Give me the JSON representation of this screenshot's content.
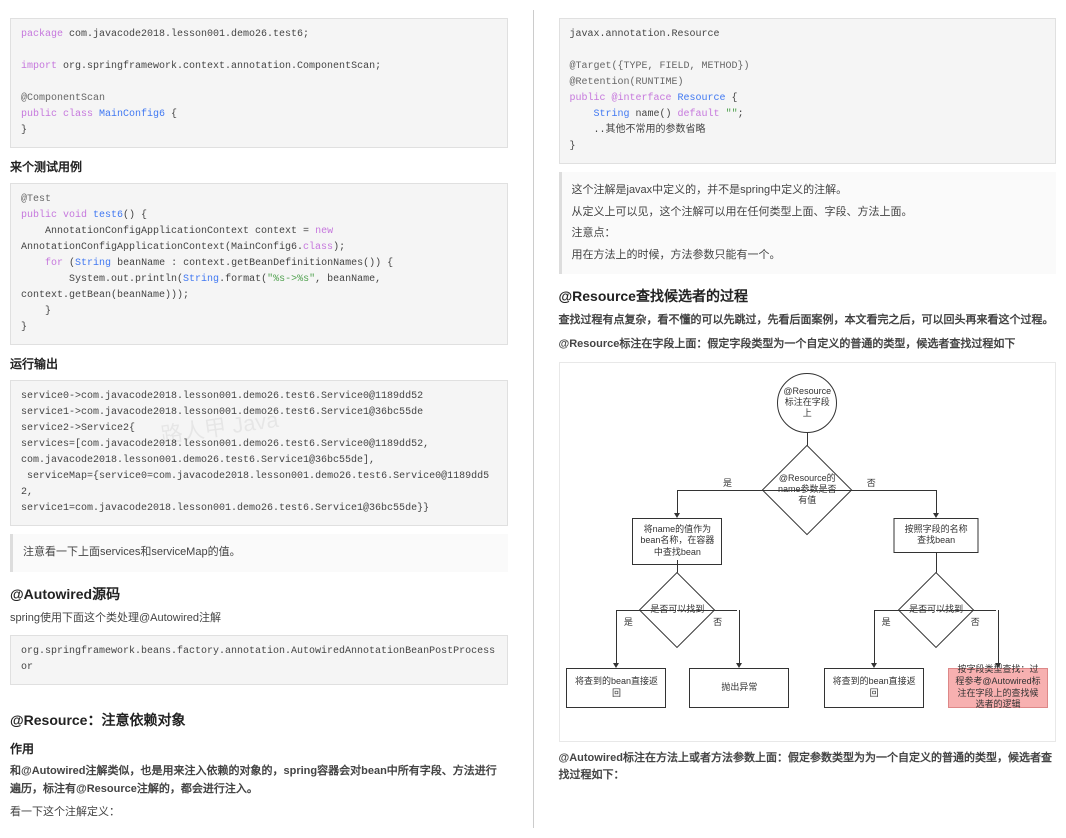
{
  "left": {
    "code1": {
      "line1_pkg": "package",
      "line1_path": " com.javacode2018.lesson001.demo26.test6;",
      "line2_import": "import",
      "line2_path": " org.springframework.context.annotation.ComponentScan;",
      "line3_annot": "@ComponentScan",
      "line4_pub": "public ",
      "line4_class": "class ",
      "line4_name": "MainConfig6",
      "line4_brace": " {",
      "line5": "}"
    },
    "h_test": "来个测试用例",
    "code2": {
      "l1": "@Test",
      "l2_pub": "public ",
      "l2_void": "void ",
      "l2_name": "test6",
      "l2_rest": "() {",
      "l3_a": "    AnnotationConfigApplicationContext context = ",
      "l3_new": "new",
      "l4": "AnnotationConfigApplicationContext(MainConfig6.",
      "l4_class": "class",
      "l4_end": ");",
      "l5_for": "    for ",
      "l5_a": "(",
      "l5_str": "String",
      "l5_b": " beanName : context.getBeanDefinitionNames()) {",
      "l6_a": "        System.out.println(",
      "l6_str": "String",
      "l6_b": ".format(",
      "l6_fmt": "\"%s->%s\"",
      "l6_c": ", beanName,",
      "l7": "context.getBean(beanName)));",
      "l8": "    }",
      "l9": "}"
    },
    "h_output": "运行输出",
    "code3": "service0->com.javacode2018.lesson001.demo26.test6.Service0@1189dd52\nservice1->com.javacode2018.lesson001.demo26.test6.Service1@36bc55de\nservice2->Service2{\nservices=[com.javacode2018.lesson001.demo26.test6.Service0@1189dd52,\ncom.javacode2018.lesson001.demo26.test6.Service1@36bc55de],\n serviceMap={service0=com.javacode2018.lesson001.demo26.test6.Service0@1189dd52,\nservice1=com.javacode2018.lesson001.demo26.test6.Service1@36bc55de}}",
    "quote1": "注意看一下上面services和serviceMap的值。",
    "h_autowired": "@Autowired源码",
    "p_spring": "spring使用下面这个类处理@Autowired注解",
    "code4": "org.springframework.beans.factory.annotation.AutowiredAnnotationBeanPostProcessor",
    "h_resource": "@Resource：注意依赖对象",
    "h_effect": "作用",
    "p_effect": "和@Autowired注解类似，也是用来注入依赖的对象的，spring容器会对bean中所有字段、方法进行遍历，标注有@Resource注解的，都会进行注入。",
    "p_look": "看一下这个注解定义："
  },
  "right": {
    "code1": {
      "l1": "javax.annotation.Resource",
      "l2_a": "@Target({TYPE, FIELD, METHOD})",
      "l3_a": "@Retention(RUNTIME)",
      "l4_pub": "public ",
      "l4_int": "@interface ",
      "l4_name": "Resource",
      "l4_end": " {",
      "l5_a": "    ",
      "l5_str": "String",
      "l5_b": " name() ",
      "l5_def": "default ",
      "l5_val": "\"\"",
      "l5_end": ";",
      "l6": "    ..其他不常用的参数省略",
      "l7": "}"
    },
    "quote1": {
      "p1": "这个注解是javax中定义的，并不是spring中定义的注解。",
      "p2": "从定义上可以见，这个注解可以用在任何类型上面、字段、方法上面。",
      "p3": "注意点：",
      "p4": "用在方法上的时候，方法参数只能有一个。"
    },
    "h_process": "@Resource查找候选者的过程",
    "p_complex": "查找过程有点复杂，看不懂的可以先跳过，先看后面案例，本文看完之后，可以回头再来看这个过程。",
    "p_field": "@Resource标注在字段上面：假定字段类型为一个自定义的普通的类型，候选者查找过程如下",
    "flowchart": {
      "start": "@Resource标注在字段上",
      "d1": "@Resource的name参数是否有值",
      "r_left": "将name的值作为bean名称，在容器中查找bean",
      "r_right": "按照字段的名称查找bean",
      "d_left": "是否可以找到",
      "d_right": "是否可以找到",
      "b1": "将查到的bean直接返回",
      "b2": "抛出异常",
      "b3": "将查到的bean直接返回",
      "b4": "按字段类型查找：过程参考@Autowired标注在字段上的查找候选者的逻辑",
      "yes": "是",
      "no": "否"
    },
    "p_method": "@Autowired标注在方法上或者方法参数上面：假定参数类型为为一个自定义的普通的类型，候选者查找过程如下："
  },
  "watermark": "路人甲 Java"
}
